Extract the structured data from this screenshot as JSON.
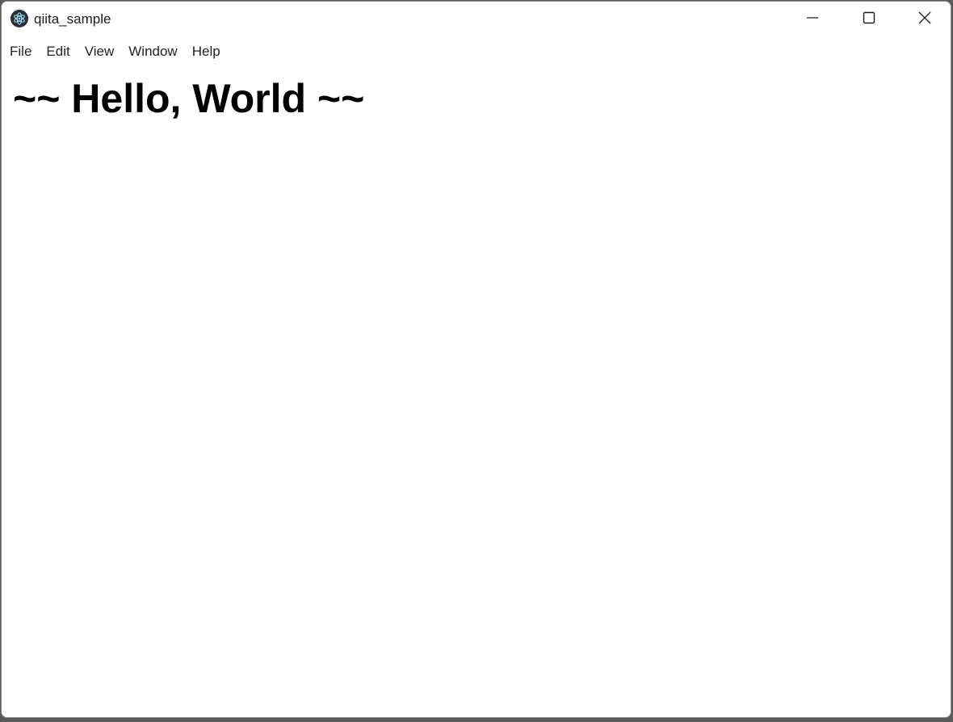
{
  "window": {
    "title": "qiita_sample",
    "icon": "electron-app-icon",
    "controls": {
      "minimize": "minimize-icon",
      "maximize": "maximize-icon",
      "close": "close-icon"
    }
  },
  "menu": {
    "items": [
      {
        "label": "File"
      },
      {
        "label": "Edit"
      },
      {
        "label": "View"
      },
      {
        "label": "Window"
      },
      {
        "label": "Help"
      }
    ]
  },
  "content": {
    "heading": "~~ Hello, World ~~"
  }
}
